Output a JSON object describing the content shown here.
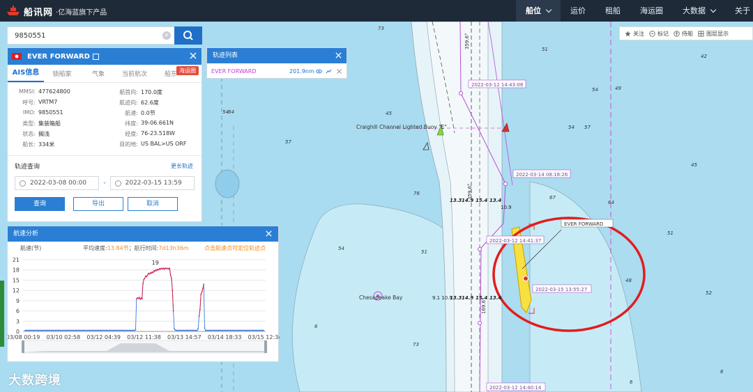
{
  "topbar": {
    "brand": "船讯网",
    "subtitle": "·亿海蓝旗下产品",
    "nav": [
      {
        "label": "船位",
        "active": true
      },
      {
        "label": "运价",
        "active": false
      },
      {
        "label": "租船",
        "active": false
      },
      {
        "label": "海运圈",
        "active": false
      },
      {
        "label": "大数据",
        "active": false
      },
      {
        "label": "关于",
        "active": false
      }
    ]
  },
  "map_tools": [
    "关注",
    "标记",
    "侍船",
    "图层显示"
  ],
  "search": {
    "value": "9850551"
  },
  "ship": {
    "name": "EVER FORWARD",
    "tabs": [
      "AIS信息",
      "锁船家",
      "气象",
      "当前航次",
      "船东"
    ],
    "badge": "海运圈",
    "info": [
      {
        "k": "MMSI:",
        "v": "477624800"
      },
      {
        "k": "船首向:",
        "v": "170.0度"
      },
      {
        "k": "呼号:",
        "v": "VRTM7"
      },
      {
        "k": "航迹向:",
        "v": "62.6度"
      },
      {
        "k": "IMO:",
        "v": "9850551"
      },
      {
        "k": "航速:",
        "v": "0.0节"
      },
      {
        "k": "类型:",
        "v": "集装箱船"
      },
      {
        "k": "纬度:",
        "v": "39-06.661N"
      },
      {
        "k": "状态:",
        "v": "搁浅"
      },
      {
        "k": "经度:",
        "v": "76-23.518W"
      },
      {
        "k": "船长:",
        "v": "334米"
      },
      {
        "k": "目的地:",
        "v": "US BAL>US ORF"
      }
    ],
    "track_query": "轨迹查询",
    "more_track": "更长轨迹",
    "date_from": "2022-03-08 00:00",
    "date_sep": "-",
    "date_to": "2022-03-15 13:59",
    "buttons": [
      "查询",
      "导出",
      "取消"
    ]
  },
  "track_list": {
    "title": "轨迹列表",
    "ship": "EVER FORWARD",
    "distance": "201.9nm"
  },
  "speed_panel": {
    "title": "航速分析",
    "unit": "航速(节)",
    "avg_label": "平均速度:",
    "avg_value": "13.84节",
    "time_label": "；航行时间:",
    "time_value": "7d13h36m",
    "tip": "点击航速点可定位轨迹点"
  },
  "chart_data": {
    "type": "line",
    "ylabel": "航速(节)",
    "ylim": [
      0,
      21
    ],
    "yticks": [
      0,
      3,
      6,
      9,
      12,
      15,
      18,
      21
    ],
    "xticks": [
      "03/08 00:19",
      "03/10 02:58",
      "03/12 04:39",
      "03/12 11:38",
      "03/13 14:57",
      "03/14 18:33",
      "03/15 12:34"
    ],
    "peak_label": "19",
    "series": [
      {
        "values": [
          0.3,
          0.3,
          0.3,
          0.3,
          0.3,
          0.3,
          0.3,
          0.3,
          0.3,
          0.3,
          0.3,
          0.3,
          0.3,
          0.3,
          0.3,
          0.3,
          0.3,
          0.3,
          0.3,
          0.3,
          0.3,
          0.3,
          0.3,
          0.3,
          0.3,
          0.3,
          0.3,
          0.3,
          0.3,
          0.3,
          0.3,
          0.3,
          0.3,
          0.3,
          0.3,
          0.3,
          0.3,
          0.3,
          0.3,
          0.3,
          0.3,
          0.3,
          0.3,
          0.3,
          0.3,
          0.3,
          0.3,
          0.3,
          0.3,
          0.3,
          0.3,
          0.3,
          0.3,
          0.3,
          0.3,
          0.3,
          0.3,
          0.3,
          0.3,
          0.3,
          0.3,
          0.3,
          0.3,
          0.3,
          0.3,
          0.3,
          0.3,
          0.3,
          0.3,
          0.3,
          0.3,
          0.3,
          0.3,
          0.3,
          0.3,
          0.3,
          0.3,
          0.3,
          0.3,
          0.3,
          0.3,
          0.3,
          0.3,
          0.3,
          0.3,
          0.3,
          0.3,
          0.3,
          0.3,
          0.3,
          0.3,
          0.3,
          0.3,
          0.3,
          0.3,
          0.3,
          0.3,
          0.3,
          0.3,
          0.3,
          0.3,
          0.3,
          0.3,
          0.3,
          0.3,
          0.3,
          0.3,
          0.3,
          0.3,
          0.3,
          0.3,
          0.3,
          0.3,
          0.3,
          0.3,
          0.3,
          0.3,
          0.3,
          0.3,
          0.3,
          0.5,
          9.5,
          9.8,
          9.6,
          10.0,
          9.4,
          9.8,
          9.5,
          14.0,
          15.2,
          15.6,
          16.2,
          16.0,
          16.5,
          17.0,
          16.8,
          17.2,
          17.0,
          17.4,
          17.2,
          17.8,
          17.6,
          18.0,
          17.8,
          18.2,
          18.0,
          18.4,
          18.2,
          18.5,
          18.3,
          18.5,
          18.2,
          18.6,
          18.4,
          18.4,
          18.5,
          18.3,
          18.5,
          16.5,
          15.5,
          12.0,
          6.0,
          0.8,
          0.4,
          0.3,
          0.3,
          0.3,
          0.3,
          0.3,
          0.3,
          0.3,
          0.3,
          0.3,
          0.3,
          0.3,
          0.3,
          0.3,
          0.3,
          0.3,
          0.3,
          0.3,
          0.3,
          0.3,
          0.3,
          0.3,
          0.3,
          0.3,
          0.3,
          0.8,
          4.5,
          6.5,
          10.8,
          11.5,
          12.5,
          13.8,
          1.0,
          0.3,
          0.3,
          0.3,
          0.3,
          0.3,
          0.3,
          0.3,
          0.3,
          0.3,
          0.3,
          0.3,
          0.3,
          0.3,
          0.3,
          0.3,
          0.3,
          0.3,
          0.3,
          0.3,
          0.3,
          0.3,
          0.3,
          0.3,
          0.3,
          0.3,
          0.3,
          0.3,
          0.3,
          0.3,
          0.3,
          0.3,
          0.3,
          0.3,
          0.3,
          0.3,
          0.3,
          0.3,
          0.3,
          0.3,
          0.3,
          0.3,
          0.3,
          0.3,
          0.3,
          0.3,
          0.3,
          0.3,
          0.3,
          0.3,
          0.3,
          0.3,
          0.3,
          0.3,
          0.3,
          0.3,
          0.3,
          0.3,
          0.3,
          0.3,
          0.3,
          0.3,
          0.3,
          0.3,
          0.3
        ]
      }
    ]
  },
  "map": {
    "buoy_label": "Craighill Channel Lighted Buoy \"E\"",
    "ship_label": "EVER FORWARD",
    "chesapeake_label": "Chesapeake Bay",
    "timestamps": [
      "2022-03-12 14:43:08",
      "2022-03-14 08:18:26",
      "2022-03-12 14:41:37",
      "2022-03-15 13:55:27",
      "2022-03-12 14:40:14"
    ],
    "bearings": [
      "359.6°",
      "359.6°",
      "169.6°"
    ],
    "channel_depths": [
      "13.3",
      "14.9",
      "15.4",
      "13.4",
      "9.1 10.9",
      "13.3",
      "14.9",
      "15.4",
      "13.4",
      "10.9"
    ],
    "soundings": [
      "73",
      "45",
      "51",
      "64",
      "42",
      "57",
      "54",
      "76",
      "48",
      "67",
      "54",
      "45",
      "64",
      "51",
      "54",
      "54",
      "51",
      "6",
      "57",
      "6",
      "49",
      "73",
      "6",
      "52"
    ]
  },
  "watermark": "大数跨境"
}
